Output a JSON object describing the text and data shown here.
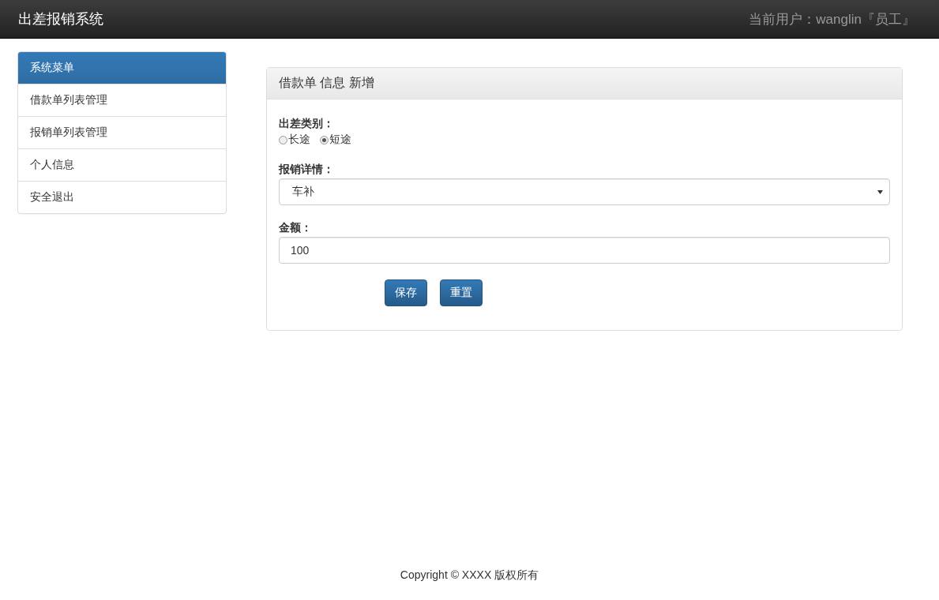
{
  "navbar": {
    "brand": "出差报销系统",
    "user": "当前用户：wanglin『员工』"
  },
  "sidebar": {
    "title": "系统菜单",
    "items": [
      {
        "label": "借款单列表管理"
      },
      {
        "label": "报销单列表管理"
      },
      {
        "label": "个人信息"
      },
      {
        "label": "安全退出"
      }
    ]
  },
  "panel": {
    "title": "借款单 信息 新增",
    "fields": [
      {
        "kind": "radio",
        "label": "出差类别：",
        "options": [
          {
            "label": "长途",
            "selected": false
          },
          {
            "label": "短途",
            "selected": true
          }
        ]
      },
      {
        "kind": "select",
        "label": "报销详情：",
        "value": "车补"
      },
      {
        "kind": "text",
        "label": "金额：",
        "value": "100"
      }
    ],
    "buttons": [
      "保存",
      "重置"
    ]
  },
  "footer": "Copyright © XXXX 版权所有"
}
